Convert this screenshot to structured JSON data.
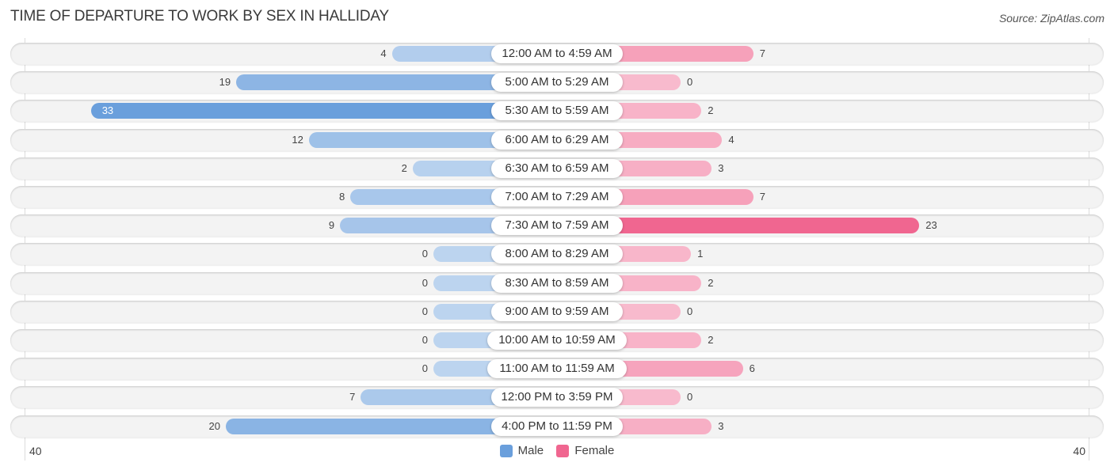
{
  "title": "TIME OF DEPARTURE TO WORK BY SEX IN HALLIDAY",
  "source": "Source: ZipAtlas.com",
  "chart_data": {
    "type": "bar",
    "orientation": "horizontal-diverging",
    "title": "TIME OF DEPARTURE TO WORK BY SEX IN HALLIDAY",
    "categories": [
      "12:00 AM to 4:59 AM",
      "5:00 AM to 5:29 AM",
      "5:30 AM to 5:59 AM",
      "6:00 AM to 6:29 AM",
      "6:30 AM to 6:59 AM",
      "7:00 AM to 7:29 AM",
      "7:30 AM to 7:59 AM",
      "8:00 AM to 8:29 AM",
      "8:30 AM to 8:59 AM",
      "9:00 AM to 9:59 AM",
      "10:00 AM to 10:59 AM",
      "11:00 AM to 11:59 AM",
      "12:00 PM to 3:59 PM",
      "4:00 PM to 11:59 PM"
    ],
    "series": [
      {
        "name": "Male",
        "color": "#6a9fdc",
        "values": [
          4,
          19,
          33,
          12,
          2,
          8,
          9,
          0,
          0,
          0,
          0,
          0,
          7,
          20
        ]
      },
      {
        "name": "Female",
        "color": "#f06690",
        "values": [
          7,
          0,
          2,
          4,
          3,
          7,
          23,
          1,
          2,
          0,
          2,
          6,
          0,
          3
        ]
      }
    ],
    "axis": {
      "left_label": "40",
      "right_label": "40",
      "range": [
        0,
        40
      ]
    },
    "legend": {
      "position": "bottom-center",
      "entries": [
        "Male",
        "Female"
      ]
    },
    "grid": false
  }
}
